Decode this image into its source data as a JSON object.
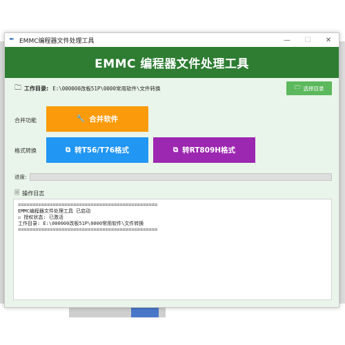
{
  "window": {
    "title": "EMMC编程器文件处理工具",
    "header": "EMMC 编程器文件处理工具"
  },
  "directory": {
    "label": "工作目录:",
    "path": "E:\\000000改板51P\\0000常用软件\\文件转换",
    "pick_button": "选择目录"
  },
  "merge": {
    "label": "合并功能",
    "button": "合并软件"
  },
  "convert": {
    "label": "格式转换",
    "button_t56": "转T56/T76格式",
    "button_rt809h": "转RT809H格式"
  },
  "progress": {
    "label": "进度:",
    "value": 0
  },
  "log": {
    "title": "操作日志",
    "lines": [
      "================================================",
      "EMMC编程器文件处理工具 已启动",
      "☑ 授权状态: 已激活",
      "工作目录: E:\\000000改板51P\\0000常用软件\\文件转换",
      "================================================"
    ]
  },
  "colors": {
    "header": "#2e7d32",
    "merge": "#fb9b0b",
    "t56": "#2196f3",
    "rt809h": "#9c27b0",
    "pick": "#5cb85c"
  }
}
